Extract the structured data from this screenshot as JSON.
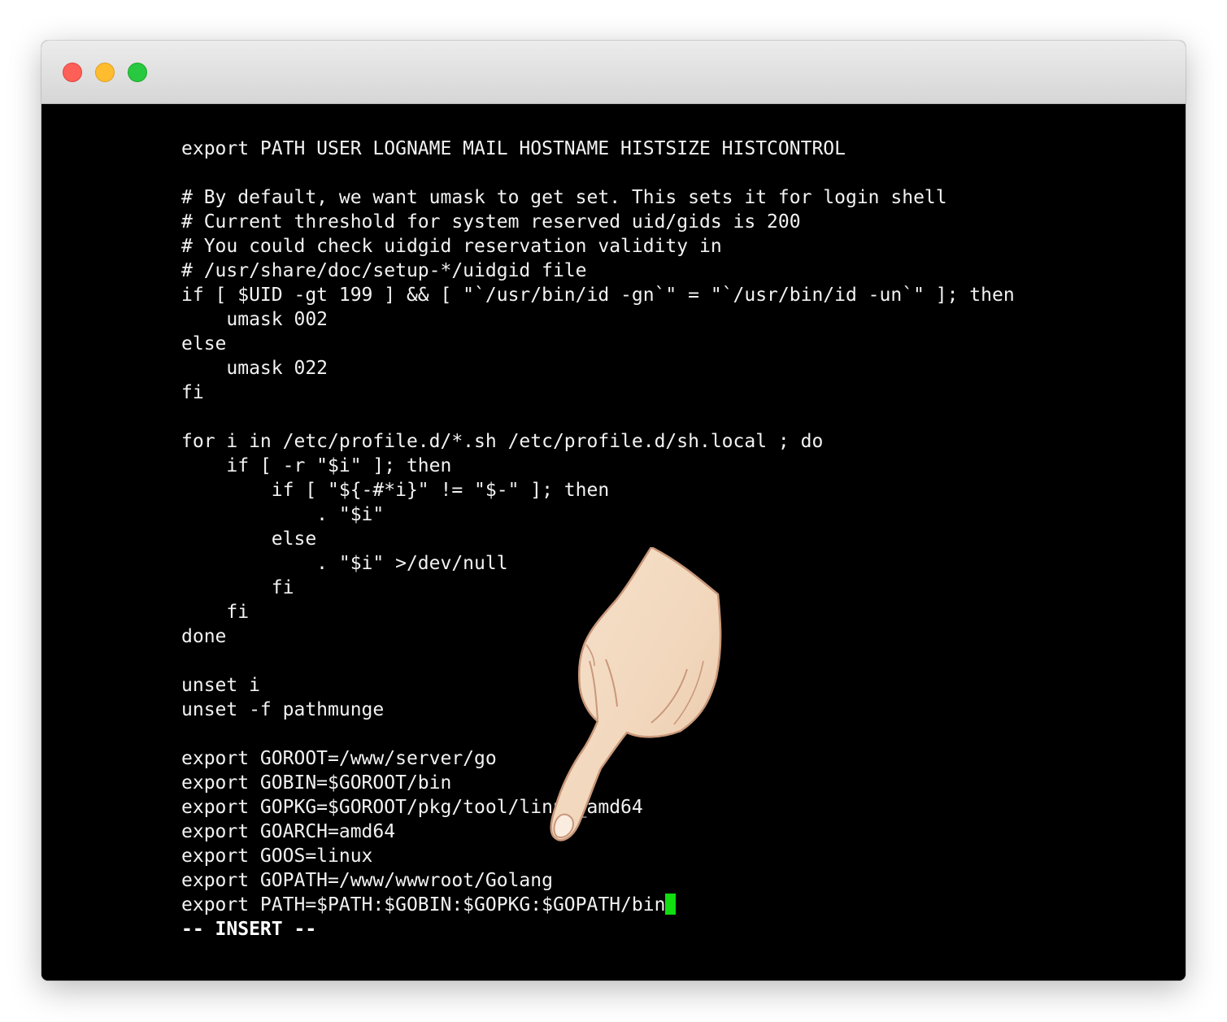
{
  "window": {
    "buttons": [
      "close",
      "minimize",
      "zoom"
    ]
  },
  "terminal": {
    "lines": [
      "export PATH USER LOGNAME MAIL HOSTNAME HISTSIZE HISTCONTROL",
      "",
      "# By default, we want umask to get set. This sets it for login shell",
      "# Current threshold for system reserved uid/gids is 200",
      "# You could check uidgid reservation validity in",
      "# /usr/share/doc/setup-*/uidgid file",
      "if [ $UID -gt 199 ] && [ \"`/usr/bin/id -gn`\" = \"`/usr/bin/id -un`\" ]; then",
      "    umask 002",
      "else",
      "    umask 022",
      "fi",
      "",
      "for i in /etc/profile.d/*.sh /etc/profile.d/sh.local ; do",
      "    if [ -r \"$i\" ]; then",
      "        if [ \"${-#*i}\" != \"$-\" ]; then",
      "            . \"$i\"",
      "        else",
      "            . \"$i\" >/dev/null",
      "        fi",
      "    fi",
      "done",
      "",
      "unset i",
      "unset -f pathmunge",
      "",
      "export GOROOT=/www/server/go",
      "export GOBIN=$GOROOT/bin",
      "export GOPKG=$GOROOT/pkg/tool/linux_amd64",
      "export GOARCH=amd64",
      "export GOOS=linux",
      "export GOPATH=/www/wwwroot/Golang",
      "export PATH=$PATH:$GOBIN:$GOPKG:$GOPATH/bin"
    ],
    "mode_indicator": "-- INSERT --",
    "cursor_color": "#11dd11"
  },
  "overlay": {
    "icon": "pointing-hand-icon"
  }
}
